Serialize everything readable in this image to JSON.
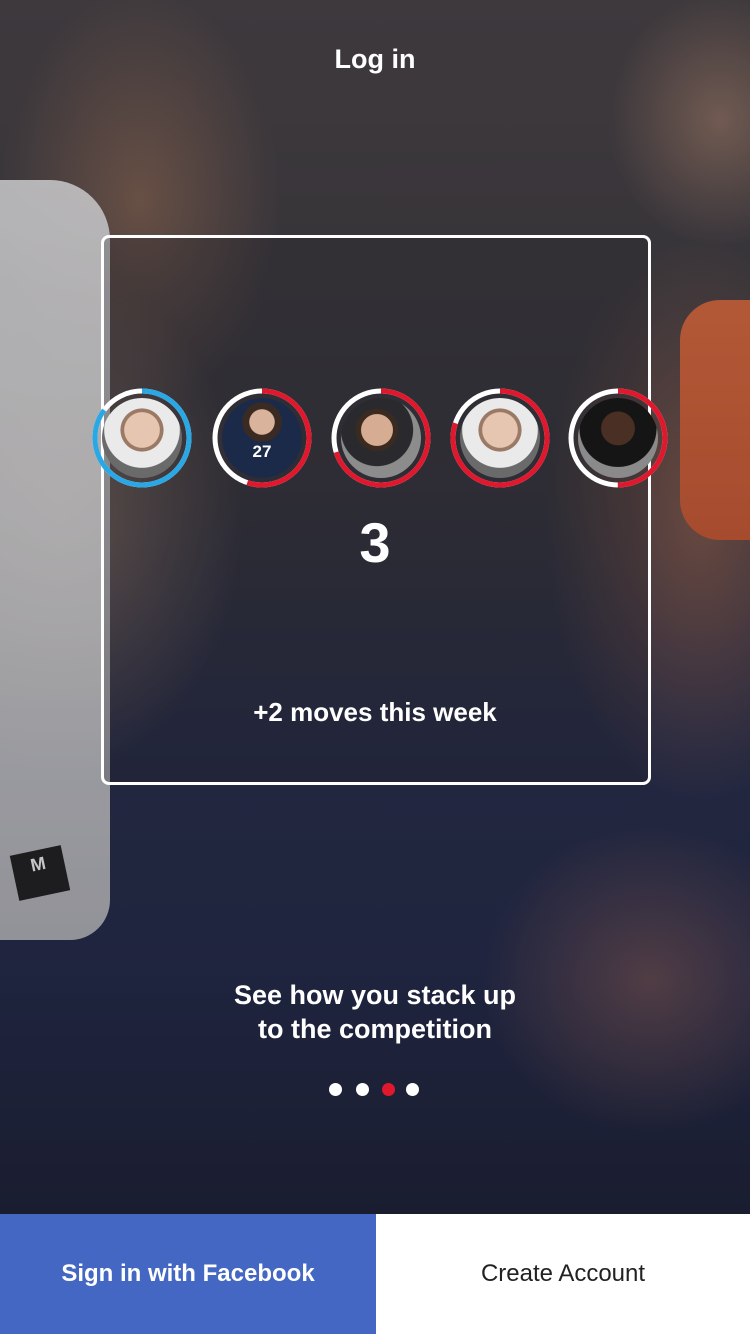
{
  "header": {
    "title": "Log in"
  },
  "card": {
    "count": "3",
    "moves_text": "+2 moves this week",
    "avatars": [
      {
        "ring_color": "#2aa8e6",
        "ring_fraction": 0.85,
        "jersey": ""
      },
      {
        "ring_color": "#e0182d",
        "ring_fraction": 0.55,
        "jersey": "27"
      },
      {
        "ring_color": "#e0182d",
        "ring_fraction": 0.7,
        "jersey": ""
      },
      {
        "ring_color": "#e0182d",
        "ring_fraction": 0.8,
        "jersey": ""
      },
      {
        "ring_color": "#e0182d",
        "ring_fraction": 0.5,
        "jersey": ""
      }
    ]
  },
  "tagline": {
    "line1": "See how you stack up",
    "line2": "to the competition"
  },
  "pagination": {
    "count": 4,
    "active_index": 2,
    "active_color": "#e0182d"
  },
  "buttons": {
    "facebook_label": "Sign in with Facebook",
    "create_label": "Create Account"
  },
  "colors": {
    "facebook": "#4367c2",
    "accent_red": "#e0182d",
    "accent_blue": "#2aa8e6"
  }
}
